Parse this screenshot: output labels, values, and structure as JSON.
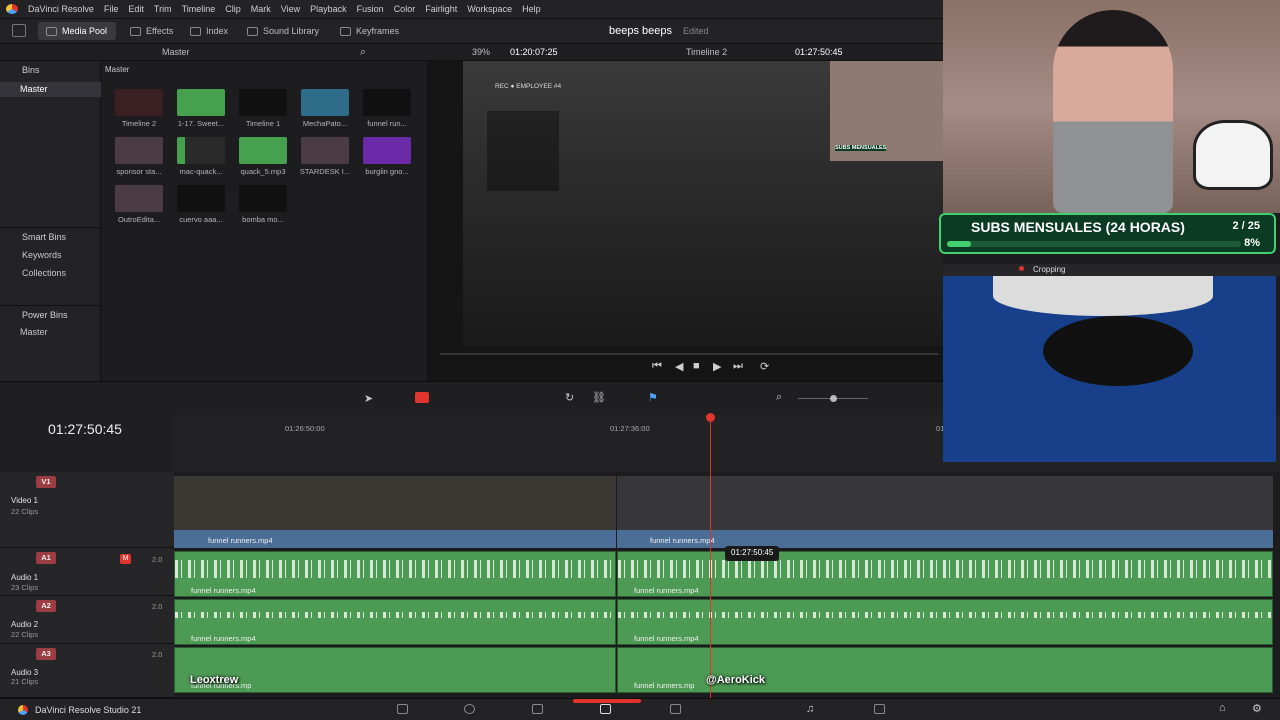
{
  "menu": {
    "app": "DaVinci Resolve",
    "items": [
      "File",
      "Edit",
      "Trim",
      "Timeline",
      "Clip",
      "Mark",
      "View",
      "Playback",
      "Fusion",
      "Color",
      "Fairlight",
      "Workspace",
      "Help"
    ]
  },
  "toolbar": {
    "media_pool": "Media Pool",
    "effects": "Effects",
    "index": "Index",
    "sound_library": "Sound Library",
    "keyframes": "Keyframes",
    "project_name": "beeps beeps",
    "project_status": "Edited"
  },
  "subbar": {
    "master": "Master",
    "zoom": "39%",
    "source_tc": "01:20:07:25",
    "timeline": "Timeline 2",
    "record_tc": "01:27:50:45"
  },
  "bins": {
    "title": "Bins",
    "master": "Master",
    "smart_bins": "Smart Bins",
    "keywords": "Keywords",
    "collections": "Collections",
    "power_bins": "Power Bins",
    "power_master": "Master"
  },
  "mediapool": {
    "header": "Master",
    "clips": [
      "Timeline 2",
      "1-17. Sweet...",
      "Timeline 1",
      "MechaPato...",
      "funnel run...",
      "sponsor sta...",
      "mac-quack...",
      "quack_5.mp3",
      "STARDESK I...",
      "burglin gno...",
      "OutroEdita...",
      "cuervo aaa...",
      "bomba mo..."
    ]
  },
  "viewer": {
    "game_rec": "REC ● EMPLOYEE #4",
    "subs_small": "SUBS MENSUALES"
  },
  "timeline": {
    "timecode": "01:27:50:45",
    "ruler_marks": [
      "01:26:50:00",
      "01:27:36:00",
      "01"
    ],
    "playhead_tooltip": "01:27:50:45",
    "tracks": [
      {
        "badge": "V1",
        "name": "Video 1",
        "clips": "22 Clips"
      },
      {
        "badge": "A1",
        "name": "Audio 1",
        "clips": "23 Clips",
        "level": "2.0"
      },
      {
        "badge": "A2",
        "name": "Audio 2",
        "clips": "22 Clips",
        "level": "2.0"
      },
      {
        "badge": "A3",
        "name": "Audio 3",
        "clips": "21 Clips",
        "level": "2.0"
      }
    ],
    "clip_name": "funnel runners.mp4",
    "clip_name_cut": "funnel runners.mp"
  },
  "stream": {
    "subs_title": "SUBS MENSUALES (24 HORAS)",
    "subs_count": "2 / 25",
    "subs_percent": "8%",
    "subs_progress": 0.08,
    "cropping": "Cropping",
    "name_left": "Leoxtrew",
    "name_right": "@AeroKick"
  },
  "bottom": {
    "app_name": "DaVinci Resolve Studio 21"
  },
  "colors": {
    "accent_red": "#e0342c",
    "progress_green": "#41d06d",
    "audio_green": "#4d9a55",
    "video_blue": "#3b4a58"
  }
}
